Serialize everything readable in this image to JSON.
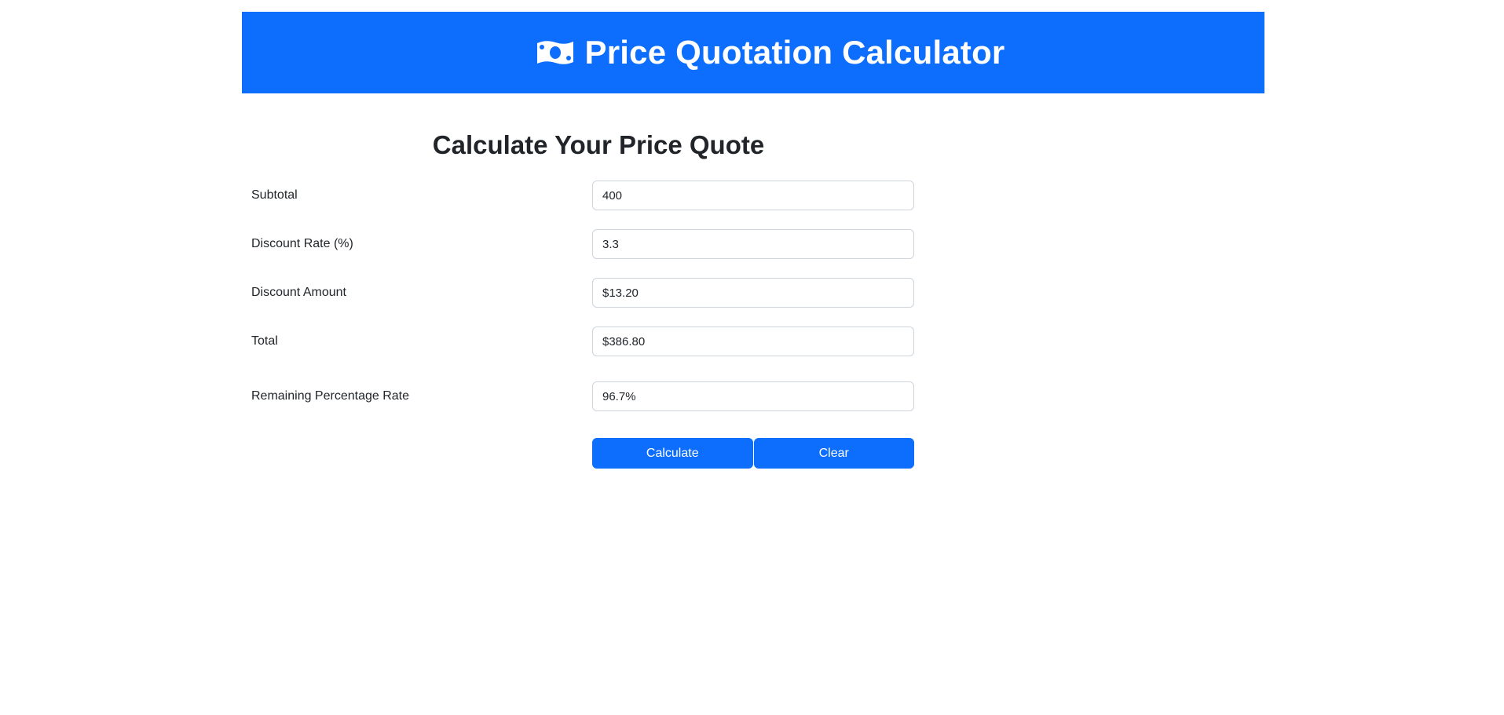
{
  "header": {
    "title": "Price Quotation Calculator",
    "icon": "money-bill-icon",
    "background": "#0d6efd"
  },
  "form": {
    "title": "Calculate Your Price Quote",
    "fields": [
      {
        "label": "Subtotal",
        "value": "400"
      },
      {
        "label": "Discount Rate (%)",
        "value": "3.3"
      },
      {
        "label": "Discount Amount",
        "value": "$13.20"
      },
      {
        "label": "Total",
        "value": "$386.80"
      },
      {
        "label": "Remaining Percentage Rate",
        "value": "96.7%"
      }
    ],
    "calculate_label": "Calculate",
    "clear_label": "Clear"
  },
  "colors": {
    "primary": "#0d6efd",
    "text": "#212529",
    "border": "#ced4da"
  }
}
